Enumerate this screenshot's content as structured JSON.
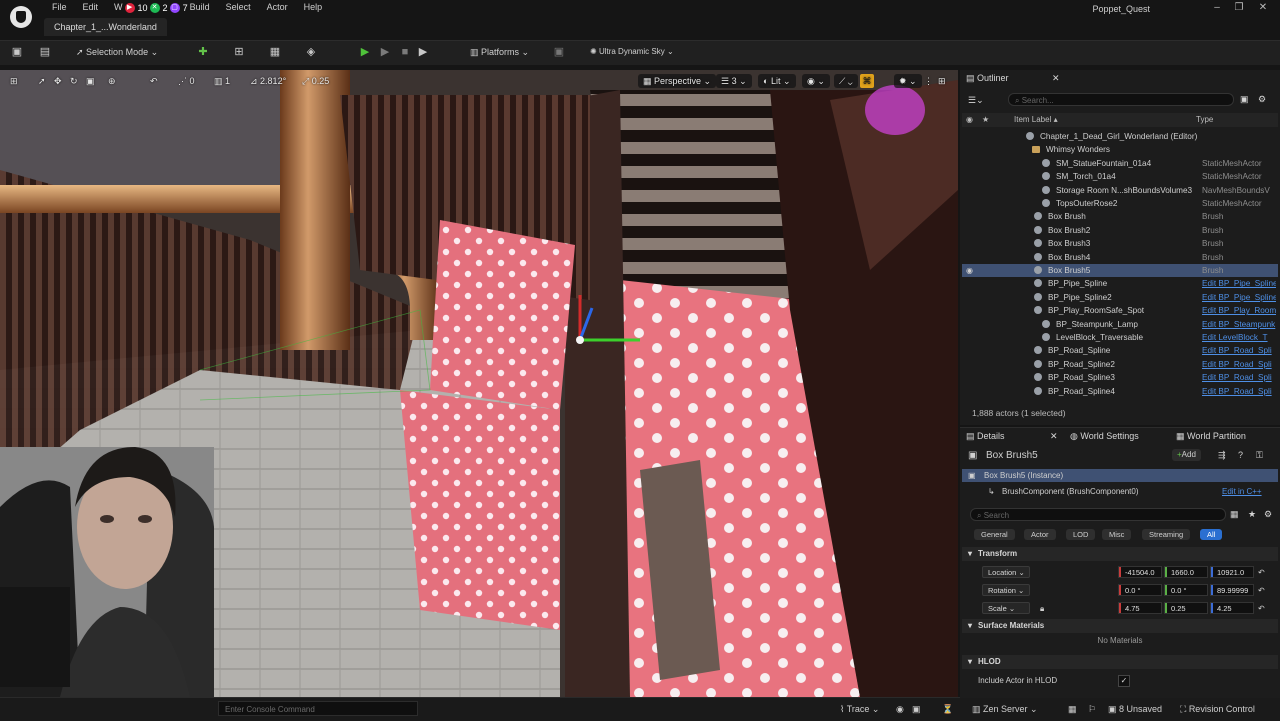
{
  "menubar": {
    "items": [
      "File",
      "Edit",
      "W",
      "Build",
      "Select",
      "Actor",
      "Help"
    ],
    "badges": [
      {
        "text": "10",
        "color": "#e0233c"
      },
      {
        "text": "2",
        "color": "#1db954"
      },
      {
        "text": "7",
        "color": "#9146ff"
      }
    ]
  },
  "document_tab": "Chapter_1_...Wonderland",
  "window_title": "Poppet_Quest",
  "window_controls": {
    "minimize": "–",
    "maximize": "❐",
    "close": "✕"
  },
  "toolbar": {
    "selection_mode": "Selection Mode",
    "platforms": "Platforms",
    "sky": "Ultra Dynamic Sky"
  },
  "viewport_toolbar": {
    "perspective": "Perspective",
    "fov_count": "3",
    "lit": "Lit",
    "grid_snap": "0",
    "rot_snap": "1",
    "scale_value": "2.812°",
    "camera_speed": "0.25"
  },
  "console": {
    "placeholder": "Enter Console Command"
  },
  "statusbar": {
    "trace": "Trace",
    "zen_server": "Zen Server",
    "unsaved": "8 Unsaved",
    "revision_control": "Revision Control"
  },
  "outliner": {
    "tab": "Outliner",
    "search_placeholder": "Search...",
    "col_label": "Item Label",
    "col_type": "Type",
    "rows": [
      {
        "label": "Chapter_1_Dead_Girl_Wonderland (Editor)",
        "type": "",
        "link": false,
        "indent": 78,
        "icon": "world"
      },
      {
        "label": "Whimsy Wonders",
        "type": "",
        "link": false,
        "indent": 84,
        "icon": "folder"
      },
      {
        "label": "SM_StatueFountain_01a4",
        "type": "StaticMeshActor",
        "link": false,
        "indent": 94,
        "icon": "mesh"
      },
      {
        "label": "SM_Torch_01a4",
        "type": "StaticMeshActor",
        "link": false,
        "indent": 94,
        "icon": "mesh"
      },
      {
        "label": "Storage Room N...shBoundsVolume3",
        "type": "NavMeshBoundsV",
        "link": false,
        "indent": 94,
        "icon": "mesh"
      },
      {
        "label": "TopsOuterRose2",
        "type": "StaticMeshActor",
        "link": false,
        "indent": 94,
        "icon": "mesh"
      },
      {
        "label": "Box Brush",
        "type": "Brush",
        "link": false,
        "indent": 86,
        "icon": "brush"
      },
      {
        "label": "Box Brush2",
        "type": "Brush",
        "link": false,
        "indent": 86,
        "icon": "brush"
      },
      {
        "label": "Box Brush3",
        "type": "Brush",
        "link": false,
        "indent": 86,
        "icon": "brush"
      },
      {
        "label": "Box Brush4",
        "type": "Brush",
        "link": false,
        "indent": 86,
        "icon": "brush"
      },
      {
        "label": "Box Brush5",
        "type": "Brush",
        "link": false,
        "indent": 86,
        "icon": "brush",
        "selected": true
      },
      {
        "label": "BP_Pipe_Spline",
        "type": "Edit BP_Pipe_Spline",
        "link": true,
        "indent": 86,
        "icon": "bp"
      },
      {
        "label": "BP_Pipe_Spline2",
        "type": "Edit BP_Pipe_Spline",
        "link": true,
        "indent": 86,
        "icon": "bp"
      },
      {
        "label": "BP_Play_RoomSafe_Spot",
        "type": "Edit BP_Play_Room",
        "link": true,
        "indent": 86,
        "icon": "bp"
      },
      {
        "label": "BP_Steampunk_Lamp",
        "type": "Edit BP_Steampunk",
        "link": true,
        "indent": 94,
        "icon": "bp"
      },
      {
        "label": "LevelBlock_Traversable",
        "type": "Edit LevelBlock_T",
        "link": true,
        "indent": 94,
        "icon": "bp"
      },
      {
        "label": "BP_Road_Spline",
        "type": "Edit BP_Road_Spli",
        "link": true,
        "indent": 86,
        "icon": "bp"
      },
      {
        "label": "BP_Road_Spline2",
        "type": "Edit BP_Road_Spli",
        "link": true,
        "indent": 86,
        "icon": "bp"
      },
      {
        "label": "BP_Road_Spline3",
        "type": "Edit BP_Road_Spli",
        "link": true,
        "indent": 86,
        "icon": "bp"
      },
      {
        "label": "BP_Road_Spline4",
        "type": "Edit BP_Road_Spli",
        "link": true,
        "indent": 86,
        "icon": "bp"
      }
    ],
    "actor_count": "1,888 actors (1 selected)"
  },
  "details": {
    "tabs": {
      "details": "Details",
      "world_settings": "World Settings",
      "world_partition": "World Partition"
    },
    "actor_name": "Box Brush5",
    "add_button": "Add",
    "instance": "Box Brush5 (Instance)",
    "component": "BrushComponent (BrushComponent0)",
    "edit_cpp": "Edit in C++",
    "search_placeholder": "Search",
    "filters": [
      "General",
      "Actor",
      "LOD",
      "Misc",
      "Streaming",
      "All"
    ],
    "active_filter": "All",
    "transform": {
      "header": "Transform",
      "location_label": "Location",
      "rotation_label": "Rotation",
      "scale_label": "Scale",
      "location": [
        "-41504.0",
        "1660.0",
        "10921.0"
      ],
      "rotation": [
        "0.0 °",
        "0.0 °",
        "89.99999"
      ],
      "scale": [
        "4.75",
        "0.25",
        "4.25"
      ]
    },
    "surface_materials": {
      "header": "Surface Materials",
      "value": "No Materials"
    },
    "hlod": {
      "header": "HLOD",
      "include_label": "Include Actor in HLOD"
    }
  }
}
